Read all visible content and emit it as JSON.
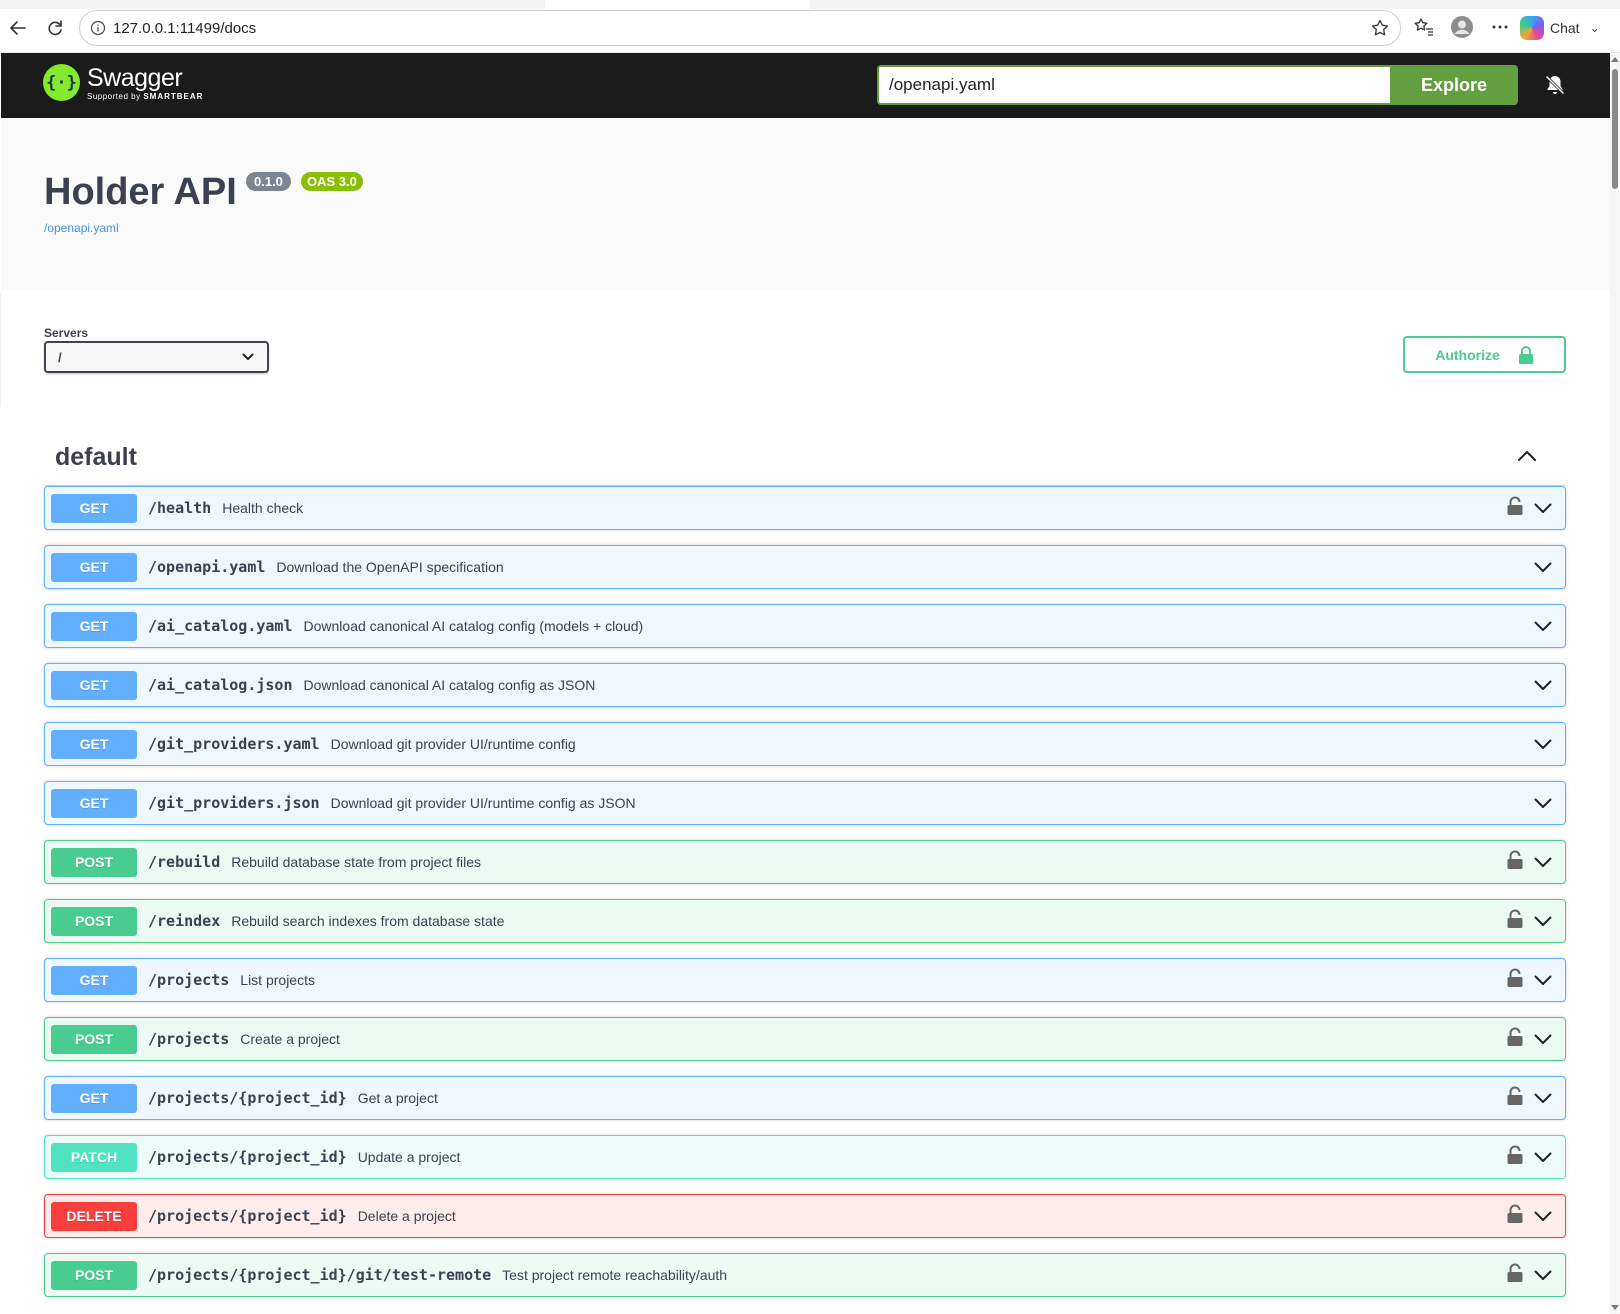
{
  "browser": {
    "url": "127.0.0.1:11499/docs",
    "chat_label": "Chat"
  },
  "topbar": {
    "logo_name": "Swagger",
    "logo_sub_prefix": "Supported by",
    "logo_sub_brand": "SMARTBEAR",
    "spec_url_value": "/openapi.yaml",
    "explore_label": "Explore"
  },
  "info": {
    "title": "Holder API",
    "version": "0.1.0",
    "oas": "OAS 3.0",
    "spec_link": "/openapi.yaml"
  },
  "servers": {
    "label": "Servers",
    "selected": "/"
  },
  "authorize": {
    "label": "Authorize"
  },
  "tag": {
    "name": "default"
  },
  "colors": {
    "get": "#61affe",
    "post": "#49cc90",
    "patch": "#50e3c2",
    "delete": "#f93e3e",
    "topbar": "#1b1b1b",
    "explore": "#62a03f"
  },
  "operations": [
    {
      "method": "GET",
      "path": "/health",
      "summary": "Health check",
      "locked": true
    },
    {
      "method": "GET",
      "path": "/openapi.yaml",
      "summary": "Download the OpenAPI specification",
      "locked": false
    },
    {
      "method": "GET",
      "path": "/ai_catalog.yaml",
      "summary": "Download canonical AI catalog config (models + cloud)",
      "locked": false
    },
    {
      "method": "GET",
      "path": "/ai_catalog.json",
      "summary": "Download canonical AI catalog config as JSON",
      "locked": false
    },
    {
      "method": "GET",
      "path": "/git_providers.yaml",
      "summary": "Download git provider UI/runtime config",
      "locked": false
    },
    {
      "method": "GET",
      "path": "/git_providers.json",
      "summary": "Download git provider UI/runtime config as JSON",
      "locked": false
    },
    {
      "method": "POST",
      "path": "/rebuild",
      "summary": "Rebuild database state from project files",
      "locked": true
    },
    {
      "method": "POST",
      "path": "/reindex",
      "summary": "Rebuild search indexes from database state",
      "locked": true
    },
    {
      "method": "GET",
      "path": "/projects",
      "summary": "List projects",
      "locked": true
    },
    {
      "method": "POST",
      "path": "/projects",
      "summary": "Create a project",
      "locked": true
    },
    {
      "method": "GET",
      "path": "/projects/{project_id}",
      "summary": "Get a project",
      "locked": true
    },
    {
      "method": "PATCH",
      "path": "/projects/{project_id}",
      "summary": "Update a project",
      "locked": true
    },
    {
      "method": "DELETE",
      "path": "/projects/{project_id}",
      "summary": "Delete a project",
      "locked": true
    },
    {
      "method": "POST",
      "path": "/projects/{project_id}/git/test-remote",
      "summary": "Test project remote reachability/auth",
      "locked": true
    }
  ]
}
